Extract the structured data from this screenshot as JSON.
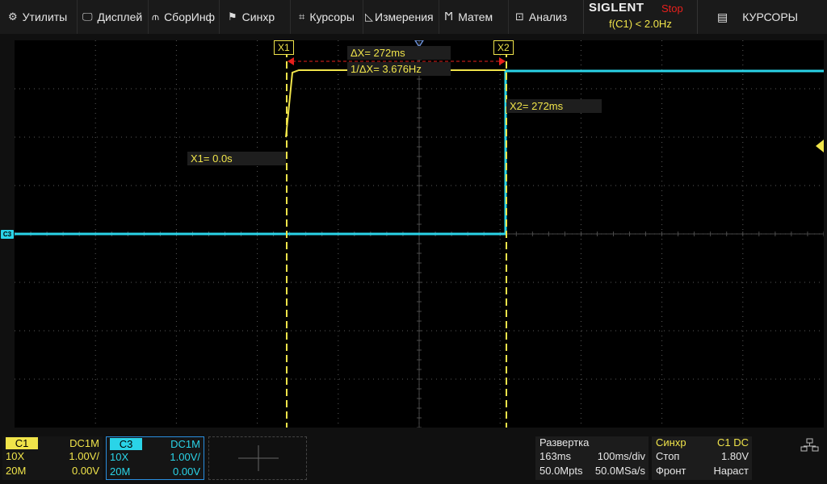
{
  "menu": {
    "items": [
      {
        "label": "Утилиты",
        "icon": "gear-icon"
      },
      {
        "label": "Дисплей",
        "icon": "monitor-icon"
      },
      {
        "label": "СборИнф",
        "icon": "acquire-icon"
      },
      {
        "label": "Синхр",
        "icon": "flag-icon"
      },
      {
        "label": "Курсоры",
        "icon": "crosshair-icon"
      },
      {
        "label": "Измерения",
        "icon": "measure-icon"
      },
      {
        "label": "Матем",
        "icon": "math-icon"
      },
      {
        "label": "Анализ",
        "icon": "analysis-icon"
      }
    ],
    "brand": "SIGLENT",
    "run_status": "Stop",
    "counter": "f(C1) < 2.0Hz",
    "cursors_menu": "КУРСОРЫ",
    "cursors_icon": "document-icon"
  },
  "colors": {
    "ch1": "#f0e44a",
    "ch3": "#2ad4e8",
    "stop": "#e8201c",
    "grid": "#5a5a5a"
  },
  "cursors": {
    "x1_tag": "X1",
    "x2_tag": "X2",
    "delta": "ΔX= 272ms",
    "inv_delta": "1/ΔX= 3.676Hz",
    "x1_value": "X1= 0.0s",
    "x2_value": "X2= 272ms"
  },
  "c3_marker": "C3",
  "channels": [
    {
      "name": "C1",
      "coupling": "DC1M",
      "probe": "10X",
      "scale": "1.00V/",
      "bandwidth": "20M",
      "offset": "0.00V"
    },
    {
      "name": "C3",
      "coupling": "DC1M",
      "probe": "10X",
      "scale": "1.00V/",
      "bandwidth": "20M",
      "offset": "0.00V"
    }
  ],
  "timebase": {
    "title": "Развертка",
    "delay": "163ms",
    "scale": "100ms/div",
    "memory": "50.0Mpts",
    "sample_rate": "50.0MSa/s"
  },
  "trigger": {
    "title": "Синхр",
    "source": "C1 DC",
    "mode": "Стоп",
    "level": "1.80V",
    "type": "Фронт",
    "slope": "Нараст"
  }
}
